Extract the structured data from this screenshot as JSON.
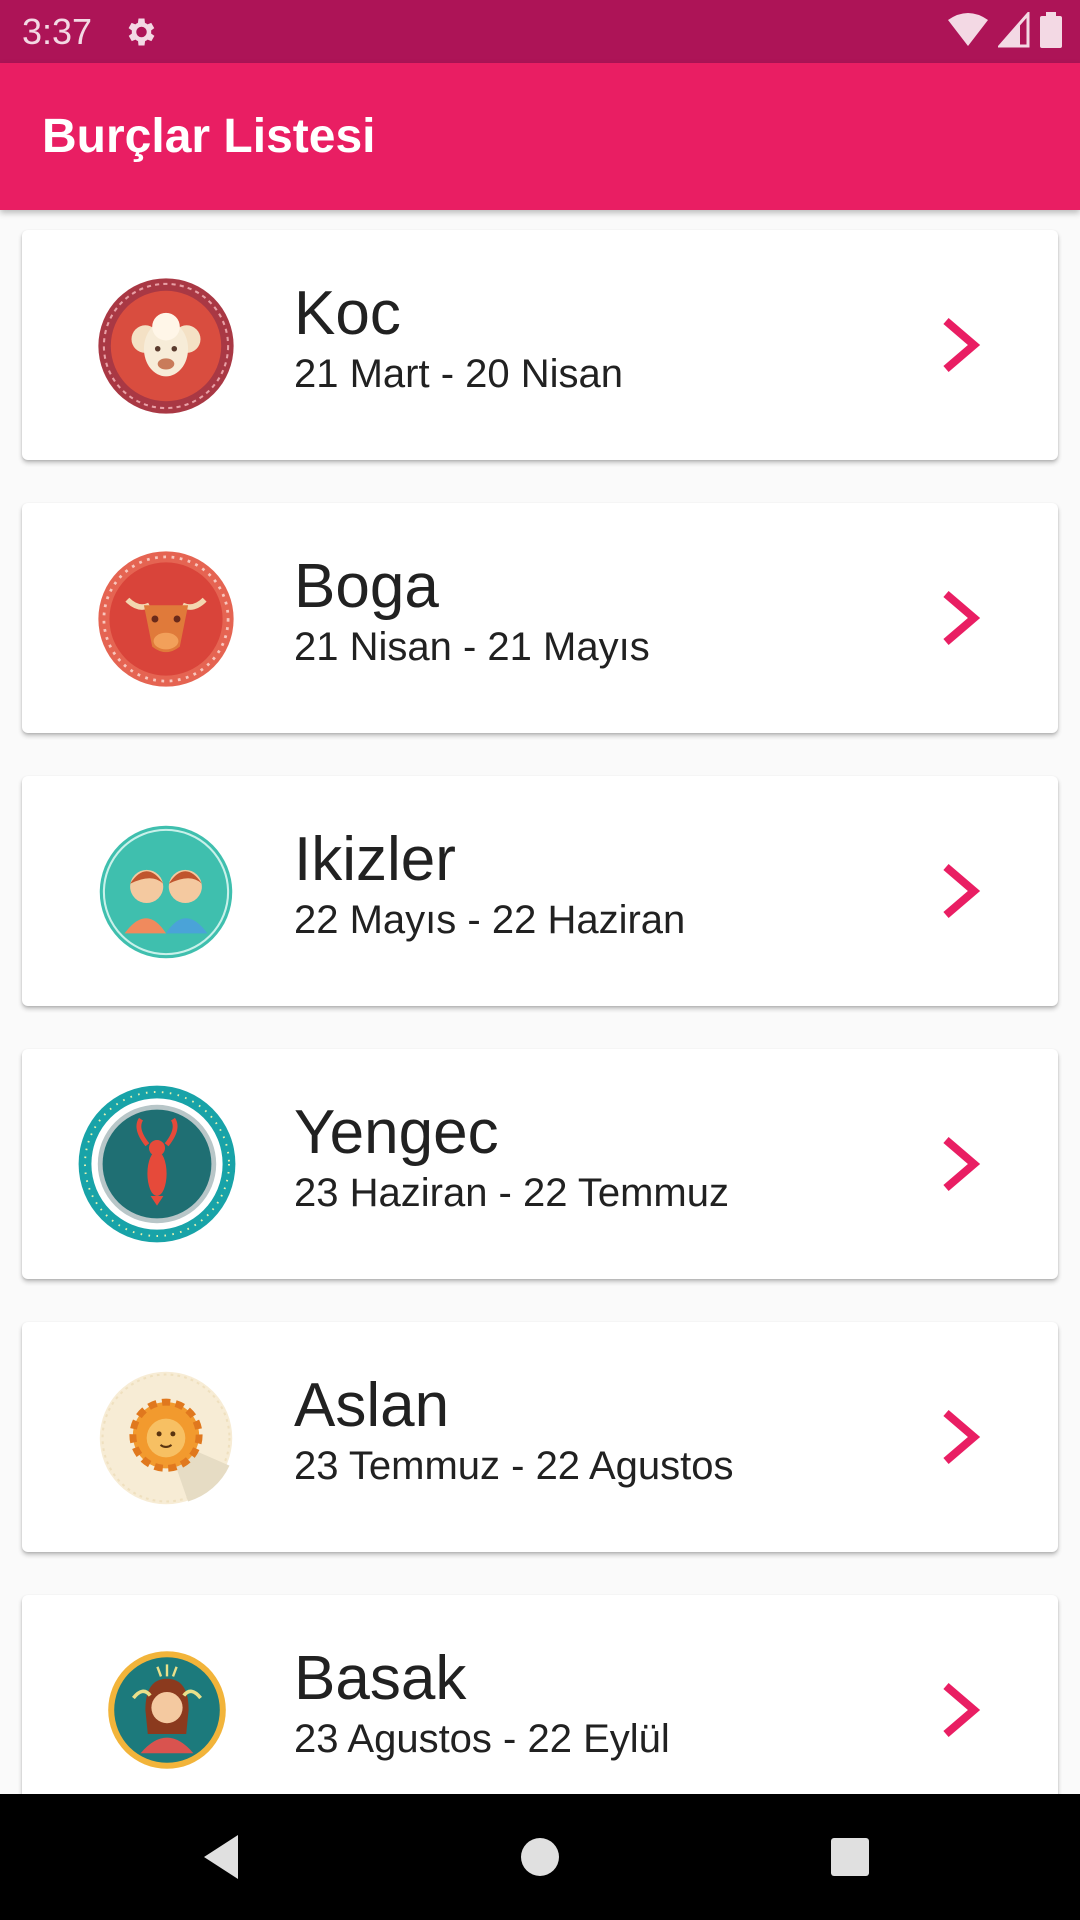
{
  "status_bar": {
    "time": "3:37",
    "icons": [
      "gear-icon",
      "wifi-icon",
      "signal-icon",
      "battery-icon"
    ]
  },
  "app_bar": {
    "title": "Burçlar Listesi"
  },
  "colors": {
    "accent": "#e91e63",
    "status_bar": "#ad1457",
    "chevron": "#e91e63"
  },
  "list": {
    "items": [
      {
        "name": "Koc",
        "dates": "21 Mart - 20 Nisan",
        "icon": "aries-icon"
      },
      {
        "name": "Boga",
        "dates": "21 Nisan - 21 Mayıs",
        "icon": "taurus-icon"
      },
      {
        "name": "Ikizler",
        "dates": "22 Mayıs - 22 Haziran",
        "icon": "gemini-icon"
      },
      {
        "name": "Yengec",
        "dates": "23 Haziran - 22 Temmuz",
        "icon": "cancer-icon"
      },
      {
        "name": "Aslan",
        "dates": "23 Temmuz - 22 Agustos",
        "icon": "leo-icon"
      },
      {
        "name": "Basak",
        "dates": "23 Agustos - 22 Eylül",
        "icon": "virgo-icon"
      }
    ]
  },
  "nav_bar": {
    "buttons": [
      "back-icon",
      "home-icon",
      "recents-icon"
    ]
  }
}
